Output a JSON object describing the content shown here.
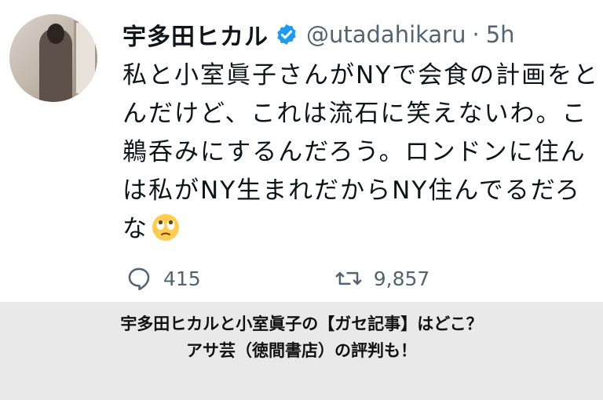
{
  "tweet": {
    "display_name": "宇多田ヒカル",
    "handle": "@utadahikaru",
    "separator": "·",
    "time": "5h",
    "lines": [
      "私と小室眞子さんがNYで会食の計画をと",
      "んだけど、これは流石に笑えないわ。こ",
      "鵜呑みにするんだろう。ロンドンに住ん",
      "は私がNY生まれだからNY住んでるだろ",
      "な"
    ],
    "emoji": "rolling-eyes-emoji",
    "replies": "415",
    "retweets": "9,857"
  },
  "banner": {
    "line1": "宇多田ヒカルと小室眞子の【ガセ記事】はどこ？",
    "line2": "アサ芸（徳間書店）の評判も！"
  },
  "colors": {
    "verified": "#1d9bf0",
    "muted": "#536471",
    "banner_bg": "#e9e9e9"
  }
}
